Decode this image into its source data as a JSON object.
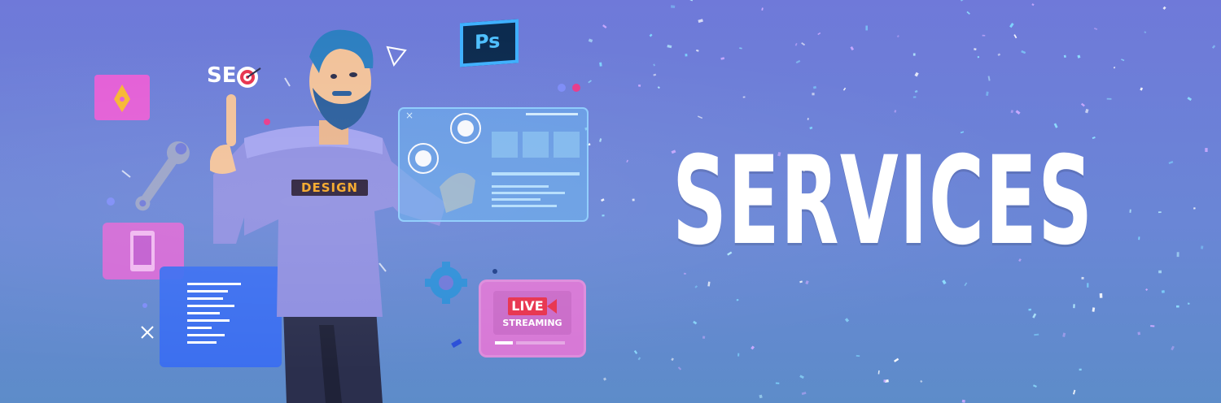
{
  "banner": {
    "heading": "SERVICES",
    "shirt_text": "DESIGN",
    "seo_text": "SE",
    "ps_text": "Ps",
    "live_text": "LIVE",
    "streaming_text": "STREAMING"
  },
  "colors": {
    "background_top": "#6f79d9",
    "background_bottom": "#5d8cc9",
    "heading": "#ffffff",
    "badge_text": "#f5a623",
    "live_red": "#e8334e"
  }
}
